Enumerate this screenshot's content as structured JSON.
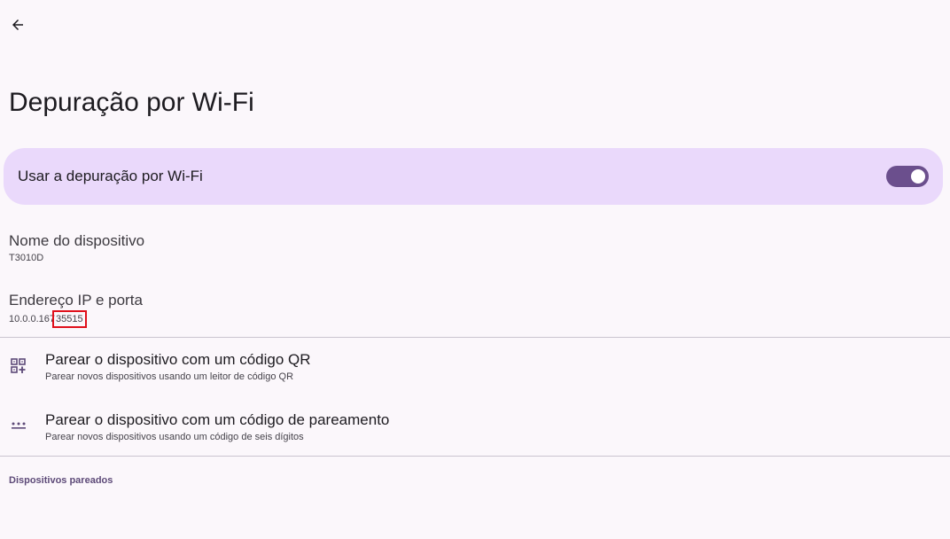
{
  "header": {
    "back_icon": "arrow-back-icon",
    "title": "Depuração por Wi-Fi"
  },
  "main_switch": {
    "label": "Usar a depuração por Wi-Fi",
    "checked": true,
    "accent_color": "#6b4f8d",
    "bar_color": "#ead9fb"
  },
  "device_name": {
    "title": "Nome do dispositivo",
    "value": "T3010D"
  },
  "ip_address": {
    "title": "Endereço IP e porta",
    "ip": "10.0.0.167",
    "port": "35515",
    "highlight_color": "#e0101c"
  },
  "pair_qr": {
    "icon": "qr-code-add-icon",
    "title": "Parear o dispositivo com um código QR",
    "summary": "Parear novos dispositivos usando um leitor de código QR"
  },
  "pair_code": {
    "icon": "dots-pin-icon",
    "title": "Parear o dispositivo com um código de pareamento",
    "summary": "Parear novos dispositivos usando um código de seis dígitos"
  },
  "paired_section": {
    "title": "Dispositivos pareados"
  }
}
